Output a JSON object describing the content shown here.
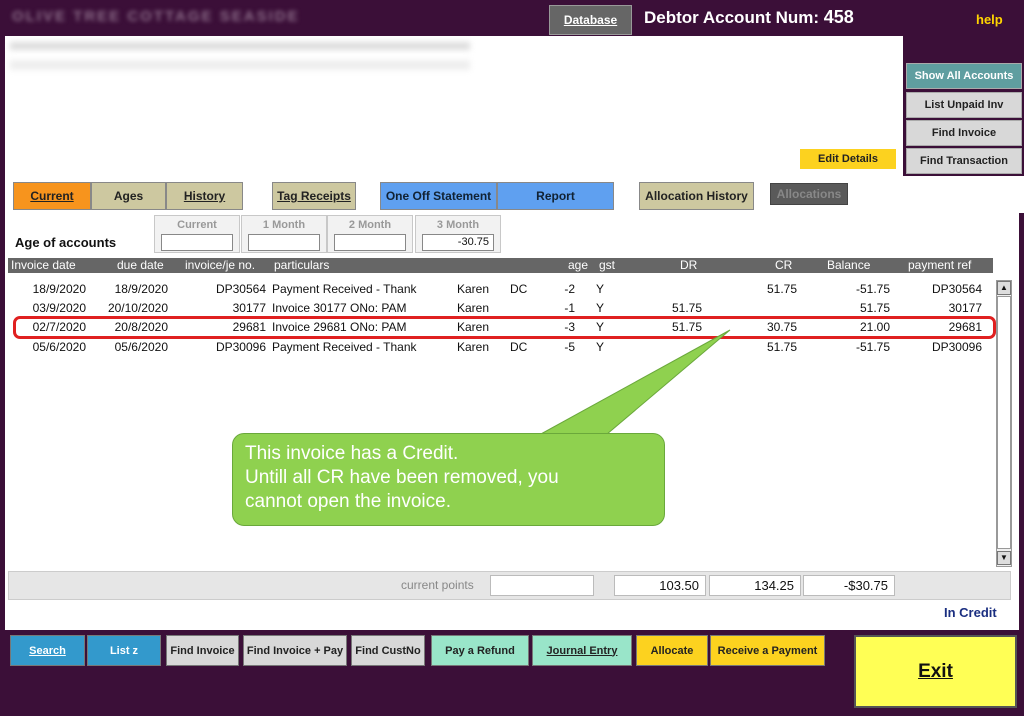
{
  "top_bar": {
    "title_blurred": "OLIVE TREE COTTAGE   SEASIDE",
    "database_button": "Database",
    "debtor_label": "Debtor Account Num:",
    "debtor_number": "458",
    "help_link": "help"
  },
  "header": {
    "edit_details_button": "Edit Details"
  },
  "right_panel": {
    "buttons": [
      "Show All Accounts",
      "List Unpaid Inv",
      "Find Invoice",
      "Find Transaction"
    ]
  },
  "tabs": [
    "Current",
    "Ages",
    "History",
    "Tag Receipts",
    "One Off Statement",
    "Report",
    "Allocation History",
    "Allocations"
  ],
  "ages": {
    "label": "Age of accounts",
    "columns": [
      {
        "label": "Current",
        "value": ""
      },
      {
        "label": "1 Month",
        "value": ""
      },
      {
        "label": "2 Month",
        "value": ""
      },
      {
        "label": "3 Month",
        "value": "-30.75"
      }
    ]
  },
  "table": {
    "headers": [
      "Invoice date",
      "due date",
      "invoice/je no.",
      "particulars",
      "age",
      "gst",
      "DR",
      "CR",
      "Balance",
      "payment ref"
    ],
    "rows": [
      {
        "invoice_date": "18/9/2020",
        "due_date": "18/9/2020",
        "invoice_no": "DP30564",
        "particulars": "Payment Received - Thank",
        "user": "Karen",
        "code": "DC",
        "age": "-2",
        "gst": "Y",
        "dr": "",
        "cr": "51.75",
        "balance": "-51.75",
        "payment_ref": "DP30564"
      },
      {
        "invoice_date": "03/9/2020",
        "due_date": "20/10/2020",
        "invoice_no": "30177",
        "particulars": "Invoice 30177 ONo: PAM",
        "user": "Karen",
        "code": "",
        "age": "-1",
        "gst": "Y",
        "dr": "51.75",
        "cr": "",
        "balance": "51.75",
        "payment_ref": "30177"
      },
      {
        "invoice_date": "02/7/2020",
        "due_date": "20/8/2020",
        "invoice_no": "29681",
        "particulars": "Invoice 29681 ONo: PAM",
        "user": "Karen",
        "code": "",
        "age": "-3",
        "gst": "Y",
        "dr": "51.75",
        "cr": "30.75",
        "balance": "21.00",
        "payment_ref": "29681"
      },
      {
        "invoice_date": "05/6/2020",
        "due_date": "05/6/2020",
        "invoice_no": "DP30096",
        "particulars": "Payment Received - Thank",
        "user": "Karen",
        "code": "DC",
        "age": "-5",
        "gst": "Y",
        "dr": "",
        "cr": "51.75",
        "balance": "-51.75",
        "payment_ref": "DP30096"
      }
    ]
  },
  "callout": {
    "line1": "This invoice has a Credit.",
    "line2": "Untill all CR have been removed, you",
    "line3": "cannot open the invoice."
  },
  "totals": {
    "current_points_label": "current points",
    "current_points_value": "",
    "dr_total": "103.50",
    "cr_total": "134.25",
    "balance_total": "-$30.75",
    "status": "In Credit"
  },
  "bottom_bar": {
    "buttons": [
      "Search",
      "List z",
      "Find Invoice",
      "Find Invoice + Pay",
      "Find CustNo",
      "Pay a Refund",
      "Journal Entry",
      "Allocate",
      "Receive a Payment"
    ],
    "exit": "Exit"
  },
  "colors": {
    "background": "#3b0f38",
    "highlight": "#e02020",
    "callout": "#8fd14f",
    "exit_button": "#ffff55"
  }
}
